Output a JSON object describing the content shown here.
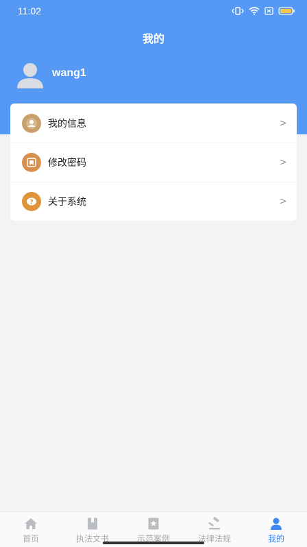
{
  "status_bar": {
    "time": "11:02",
    "icons": [
      "vibrate-icon",
      "wifi-icon",
      "sim-icon",
      "battery-icon"
    ]
  },
  "header": {
    "title": "我的",
    "username": "wang1",
    "background_color": "#5599f5"
  },
  "menu": {
    "items": [
      {
        "label": "我的信息",
        "icon": "user-info-icon",
        "icon_color": "#c9a06a",
        "arrow": ">"
      },
      {
        "label": "修改密码",
        "icon": "password-icon",
        "icon_color": "#d7914f",
        "arrow": ">"
      },
      {
        "label": "关于系统",
        "icon": "about-icon",
        "icon_color": "#e0943a",
        "arrow": ">"
      }
    ]
  },
  "tabbar": {
    "tabs": [
      {
        "label": "首页",
        "icon": "home-icon",
        "active": false
      },
      {
        "label": "执法文书",
        "icon": "document-icon",
        "active": false
      },
      {
        "label": "示范案例",
        "icon": "case-icon",
        "active": false
      },
      {
        "label": "法律法规",
        "icon": "gavel-icon",
        "active": false
      },
      {
        "label": "我的",
        "icon": "person-icon",
        "active": true
      }
    ],
    "active_color": "#3e86f2",
    "inactive_color": "#aaaaaa"
  }
}
